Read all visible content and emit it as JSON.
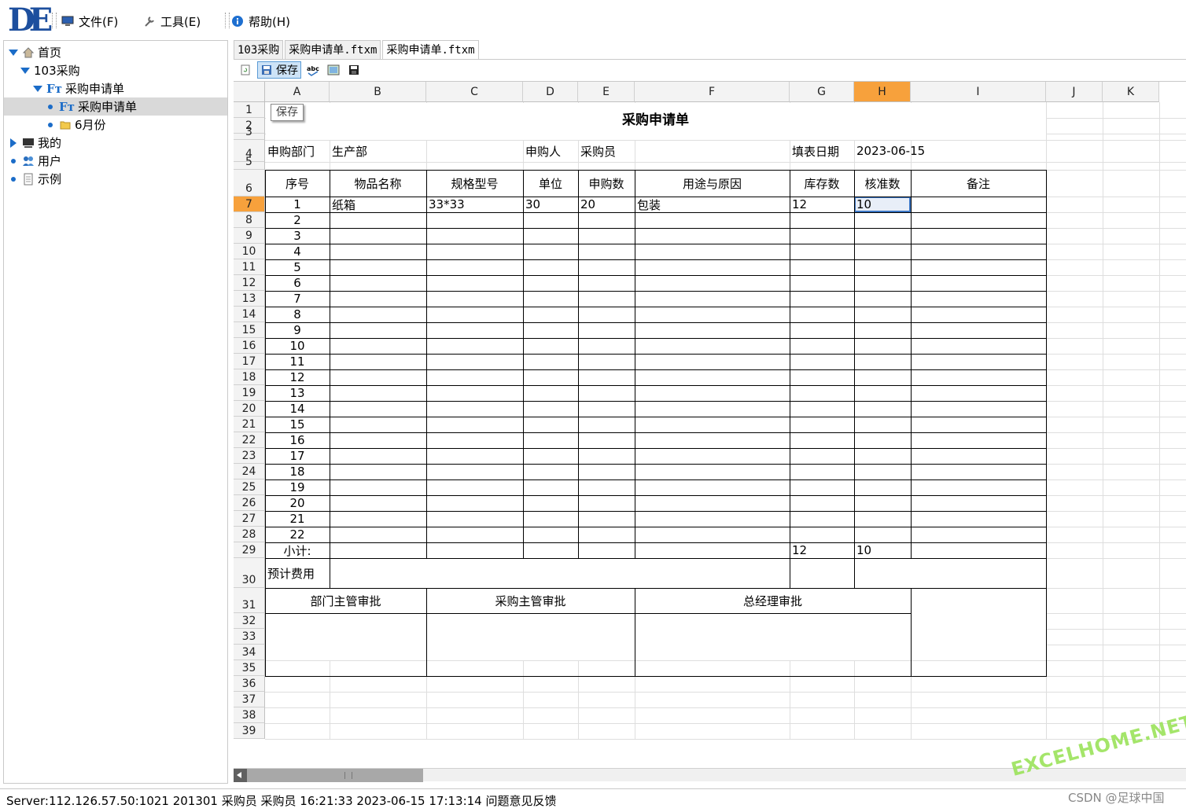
{
  "app": {
    "logo": "DE",
    "menu": [
      {
        "label": "文件(F)",
        "icon": "computer-icon"
      },
      {
        "label": "工具(E)",
        "icon": "wrench-icon"
      },
      {
        "label": "帮助(H)",
        "icon": "info-icon"
      }
    ]
  },
  "tree": {
    "items": [
      {
        "label": "首页",
        "icon": "home-icon",
        "expander": "expanded"
      },
      {
        "label": "103采购",
        "expander": "expanded"
      },
      {
        "label": "采购申请单",
        "icon": "ft-icon",
        "expander": "expanded"
      },
      {
        "label": "采购申请单",
        "icon": "ft-icon",
        "expander": "leaf",
        "selected": true
      },
      {
        "label": "6月份",
        "icon": "folder-icon",
        "expander": "leaf"
      },
      {
        "label": "我的",
        "icon": "monitor-icon",
        "expander": "collapsed"
      },
      {
        "label": "用户",
        "icon": "users-icon",
        "expander": "leaf"
      },
      {
        "label": "示例",
        "icon": "document-icon",
        "expander": "leaf"
      }
    ]
  },
  "tabs": [
    {
      "label": "103采购",
      "active": false
    },
    {
      "label": "采购申请单.ftxm",
      "active": false
    },
    {
      "label": "采购申请单.ftxm",
      "active": true
    }
  ],
  "toolbar": {
    "save_label": "保存",
    "tooltip": "保存",
    "icons": [
      "refresh-icon",
      "save-icon",
      "spellcheck-icon",
      "image-icon",
      "floppy-icon"
    ]
  },
  "sheet": {
    "columns": [
      "A",
      "B",
      "C",
      "D",
      "E",
      "F",
      "G",
      "H",
      "I",
      "J",
      "K"
    ],
    "selected_column": "H",
    "selected_row": "7",
    "rows": [
      "1",
      "2",
      "3",
      "4",
      "5",
      "6",
      "7",
      "8",
      "9",
      "10",
      "11",
      "12",
      "13",
      "14",
      "15",
      "16",
      "17",
      "18",
      "19",
      "20",
      "21",
      "22",
      "23",
      "24",
      "25",
      "26",
      "27",
      "28",
      "29",
      "30",
      "31",
      "32",
      "33",
      "34",
      "35",
      "36",
      "37",
      "38",
      "39"
    ],
    "form": {
      "title": "采购申请单",
      "dept_label": "申购部门",
      "dept_value": "生产部",
      "applicant_label": "申购人",
      "applicant_value": "采购员",
      "date_label": "填表日期",
      "date_value": "2023-06-15",
      "headers": [
        "序号",
        "物品名称",
        "规格型号",
        "单位",
        "申购数",
        "用途与原因",
        "库存数",
        "核准数",
        "备注"
      ],
      "row1": {
        "no": "1",
        "name": "纸箱",
        "spec": "33*33",
        "unit": "30",
        "qty": "20",
        "purpose": "包装",
        "stock": "12",
        "approved": "10",
        "note": ""
      },
      "seq": [
        "2",
        "3",
        "4",
        "5",
        "6",
        "7",
        "8",
        "9",
        "10",
        "11",
        "12",
        "13",
        "14",
        "15",
        "16",
        "17",
        "18",
        "19",
        "20",
        "21",
        "22"
      ],
      "subtotal_label": "小计:",
      "subtotal_stock": "12",
      "subtotal_approved": "10",
      "estimate_label": "预计费用",
      "approvals": [
        "部门主管审批",
        "采购主管审批",
        "总经理审批"
      ]
    }
  },
  "status": {
    "text": "Server:112.126.57.50:1021  201301 采购员 采购员 16:21:33 2023-06-15 17:13:14  问题意见反馈"
  },
  "overlay": {
    "watermark": "EXCELHOME.NET",
    "credit": "CSDN @足球中国"
  }
}
